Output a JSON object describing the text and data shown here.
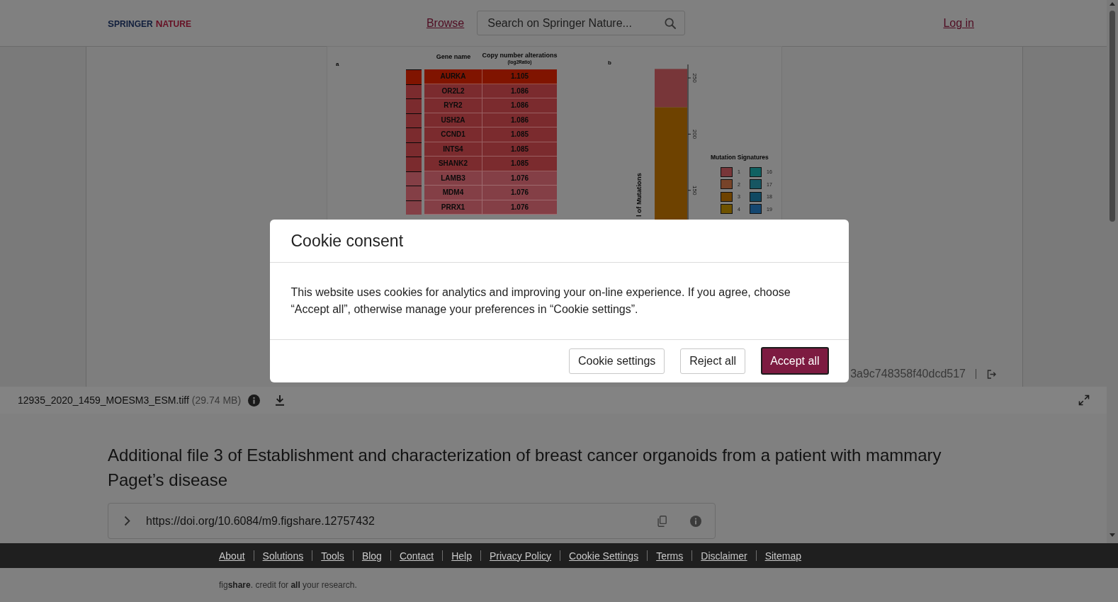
{
  "header": {
    "logo": [
      "SPRINGER",
      "NATURE"
    ],
    "browse_link": "Browse",
    "search": {
      "placeholder": "Search on Springer Nature..."
    },
    "login_link": "Log in"
  },
  "viewer": {
    "figure": {
      "panel_a": {
        "label": "a",
        "columns": [
          "Gene name",
          "Copy number alterations"
        ],
        "column_note": "(log2Ratio)",
        "rows": [
          {
            "gene": "AURKA",
            "value": "1.105",
            "color": "#801400"
          },
          {
            "gene": "OR2L2",
            "value": "1.086",
            "color": "#7b2b2e"
          },
          {
            "gene": "RYR2",
            "value": "1.086",
            "color": "#7b2b2e"
          },
          {
            "gene": "USH2A",
            "value": "1.086",
            "color": "#7b2b2e"
          },
          {
            "gene": "CCND1",
            "value": "1.085",
            "color": "#7b2b2e"
          },
          {
            "gene": "INTS4",
            "value": "1.085",
            "color": "#7b2b2e"
          },
          {
            "gene": "SHANK2",
            "value": "1.085",
            "color": "#7b2b2e"
          },
          {
            "gene": "LAMB3",
            "value": "1.076",
            "color": "#843f46"
          },
          {
            "gene": "MDM4",
            "value": "1.076",
            "color": "#843f46"
          },
          {
            "gene": "PRRX1",
            "value": "1.076",
            "color": "#843f46"
          }
        ]
      },
      "panel_b": {
        "label": "b",
        "chart_data": {
          "type": "bar",
          "stacked": true,
          "ylabel": "l of Mutations",
          "categories": [
            null
          ],
          "ylim": [
            0,
            262
          ],
          "yticks": [
            150,
            200,
            250
          ],
          "series": [
            {
              "color": "#6e4200",
              "values": [
                224
              ]
            },
            {
              "color": "#783639",
              "values": [
                34
              ]
            }
          ]
        },
        "legend_title": "Mutation Signatures",
        "legend": [
          {
            "label": "1",
            "color": "#783639"
          },
          {
            "label": "2",
            "color": "#774329"
          },
          {
            "label": "3",
            "color": "#6e4200"
          },
          {
            "label": "4",
            "color": "#6e5200"
          },
          {
            "label": "16",
            "color": "#0f6161"
          },
          {
            "label": "17",
            "color": "#165662"
          },
          {
            "label": "18",
            "color": "#104962"
          },
          {
            "label": "19",
            "color": "#154770"
          }
        ]
      }
    },
    "checksum": "3a9c748358f40dcd517"
  },
  "file_bar": {
    "file_name": "12935_2020_1459_MOESM3_ESM.tiff",
    "file_size": "(29.74 MB)"
  },
  "item": {
    "title": "Additional file 3 of Establishment and characterization of breast cancer organoids from a patient with mammary Paget’s disease",
    "doi": {
      "url": "https://doi.org/10.6084/m9.figshare.12757432",
      "expanded": false
    }
  },
  "footer": {
    "links": [
      "About",
      "Solutions",
      "Tools",
      "Blog",
      "Contact",
      "Help",
      "Privacy Policy",
      "Cookie Settings",
      "Terms",
      "Disclaimer",
      "Sitemap"
    ],
    "tagline": "fig**share**. credit for **all** your research."
  },
  "cookie_dialog": {
    "title": "Cookie consent",
    "message": "This website uses cookies for analytics and improving your on-line experience. If you agree, choose “Accept all”, otherwise manage your preferences in “Cookie settings”.",
    "buttons": [
      {
        "label": "Cookie settings",
        "kind": "secondary",
        "focused": false
      },
      {
        "label": "Reject all",
        "kind": "secondary",
        "focused": false
      },
      {
        "label": "Accept all",
        "kind": "primary",
        "focused": true
      }
    ]
  }
}
